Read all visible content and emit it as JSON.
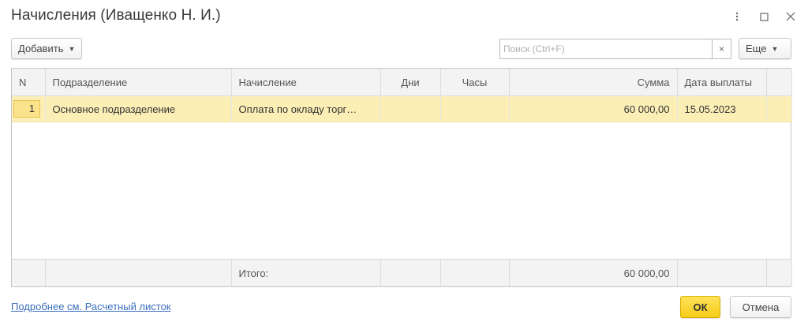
{
  "window": {
    "title": "Начисления (Иващенко Н. И.)"
  },
  "toolbar": {
    "add_label": "Добавить",
    "more_label": "Еще",
    "search_placeholder": "Поиск (Ctrl+F)",
    "clear_glyph": "×"
  },
  "table": {
    "columns": [
      "N",
      "Подразделение",
      "Начисление",
      "Дни",
      "Часы",
      "Сумма",
      "Дата выплаты"
    ],
    "rows": [
      {
        "n": "1",
        "department": "Основное подразделение",
        "accrual": "Оплата по окладу торг…",
        "days": "",
        "hours": "",
        "sum": "60 000,00",
        "pay_date": "15.05.2023"
      }
    ],
    "footer": {
      "label": "Итого:",
      "sum": "60 000,00"
    }
  },
  "bottom": {
    "link": "Подробнее см. Расчетный листок",
    "ok_label": "ОК",
    "cancel_label": "Отмена"
  },
  "colors": {
    "selected_row": "#fbefb6",
    "ok_button": "#f5cc17",
    "link": "#3b6ebf"
  }
}
